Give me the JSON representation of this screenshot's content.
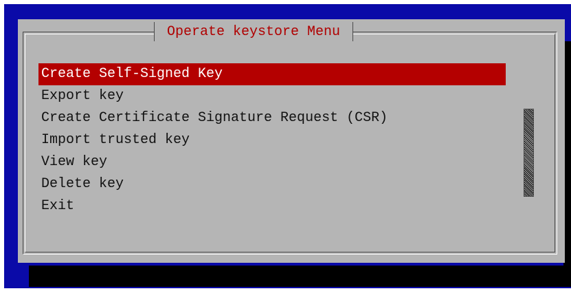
{
  "dialog": {
    "title": "Operate keystore Menu",
    "items": [
      "Create Self-Signed Key",
      "Export key",
      "Create Certificate Signature Request (CSR)",
      "Import trusted key",
      "View key",
      "Delete key",
      "Exit"
    ],
    "selected_index": 0
  },
  "colors": {
    "background": "#0a0aa8",
    "dialog": "#b5b5b5",
    "title": "#b00000",
    "selection": "#b40000"
  }
}
